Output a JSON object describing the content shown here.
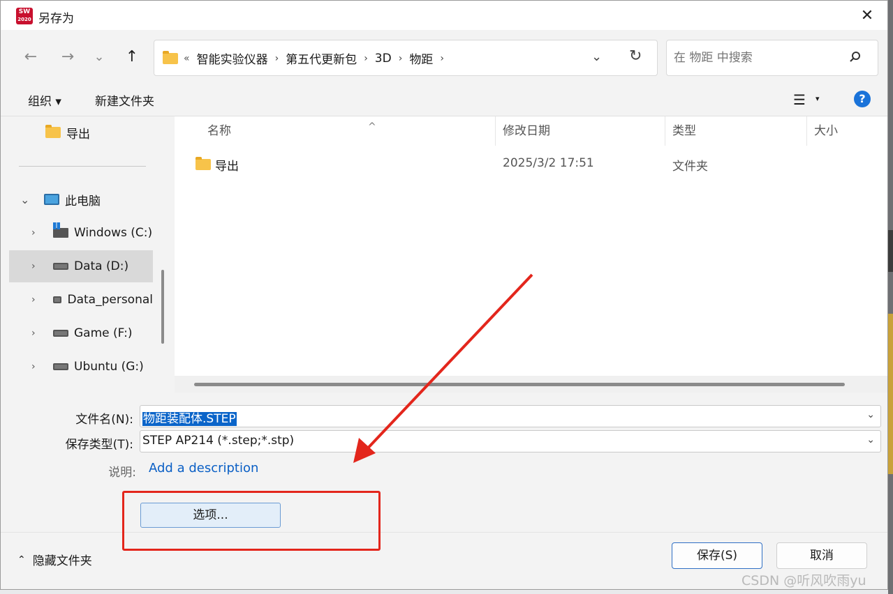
{
  "window": {
    "title": "另存为",
    "app_badge_top": "SW",
    "app_badge_bottom": "2020",
    "close_glyph": "✕"
  },
  "nav": {
    "back_glyph": "←",
    "forward_glyph": "→",
    "recent_glyph": "⌄",
    "up_glyph": "↑",
    "breadcrumb_lead": "«",
    "breadcrumb": [
      "智能实验仪器",
      "第五代更新包",
      "3D",
      "物距"
    ],
    "breadcrumb_sep": "›",
    "dropdown_glyph": "⌄",
    "refresh_glyph": "↻"
  },
  "search": {
    "placeholder": "在 物距 中搜索"
  },
  "toolbar": {
    "organize": "组织 ▾",
    "new_folder": "新建文件夹",
    "view_glyph": "☰",
    "view_dd": "▾",
    "help": "?"
  },
  "sidebar": {
    "quick": {
      "label": "导出"
    },
    "pc": {
      "label": "此电脑",
      "chev": "⌄"
    },
    "drives": [
      {
        "label": "Windows (C:)",
        "chev": "›"
      },
      {
        "label": "Data (D:)",
        "chev": "›"
      },
      {
        "label": "Data_personal",
        "chev": "›"
      },
      {
        "label": "Game (F:)",
        "chev": "›"
      },
      {
        "label": "Ubuntu (G:)",
        "chev": "›"
      }
    ]
  },
  "files": {
    "columns": [
      "名称",
      "修改日期",
      "类型",
      "大小"
    ],
    "sort_glyph": "^",
    "rows": [
      {
        "name": "导出",
        "date": "2025/3/2 17:51",
        "type": "文件夹"
      }
    ]
  },
  "form": {
    "filename_label": "文件名(N):",
    "filename_value": "物距装配体.STEP",
    "type_label": "保存类型(T):",
    "type_value": "STEP AP214 (*.step;*.stp)",
    "desc_label": "说明:",
    "desc_link": "Add a description",
    "options_button": "选项...",
    "dd_glyph": "⌄"
  },
  "bottom": {
    "hide_folders": "隐藏文件夹",
    "hide_chev": "⌃",
    "save": "保存(S)",
    "cancel": "取消"
  },
  "watermark": "CSDN @听风吹雨yu",
  "colors": {
    "accent": "#0a64c9",
    "annotation": "#e3261c",
    "link": "#0a5fc5"
  }
}
